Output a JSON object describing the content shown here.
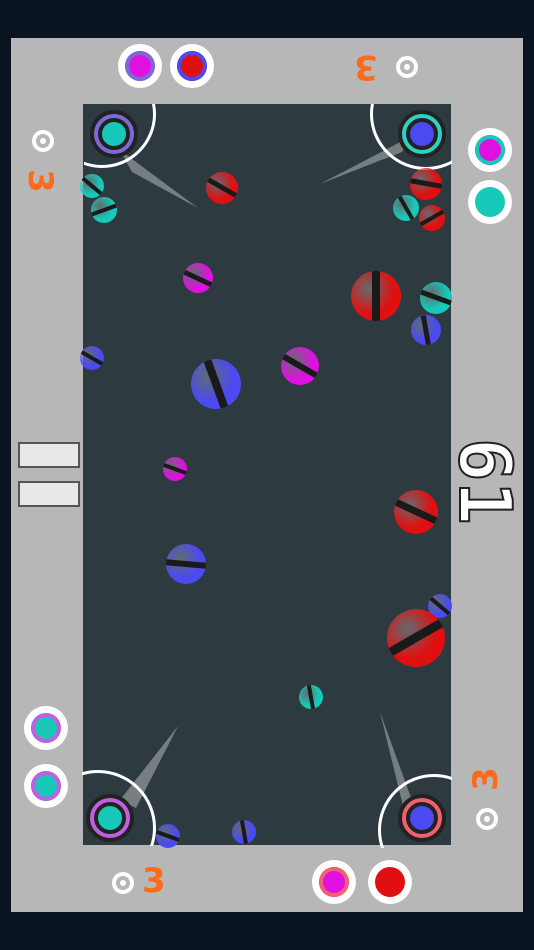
{
  "timer": {
    "value": "61"
  },
  "scores": {
    "top_right": "3",
    "left": "3",
    "right": "3",
    "bottom_left": "3"
  },
  "colors": {
    "red": "#e01010",
    "blue": "#4a4af0",
    "cyan": "#18c8b8",
    "magenta": "#e010e0",
    "orange": "#ff6a1a",
    "field": "#2d3a40",
    "frame": "#b7b7b7"
  },
  "icons": {
    "pause": "pause-icon",
    "ring": "ring-icon"
  }
}
